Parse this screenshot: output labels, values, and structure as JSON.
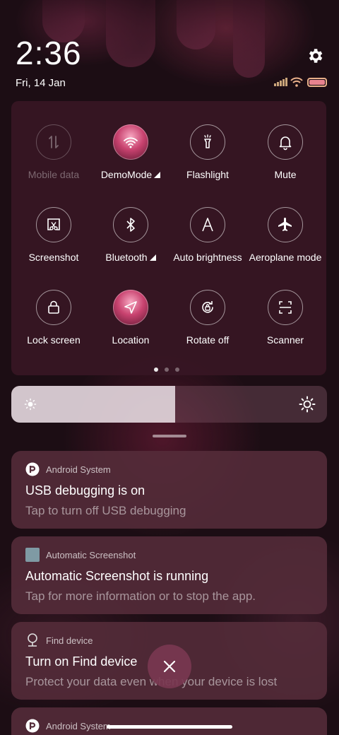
{
  "status_bar": {
    "time": "2:36",
    "date": "Fri, 14 Jan",
    "icons": [
      "signal-icon",
      "wifi-icon",
      "battery-icon"
    ]
  },
  "quick_settings": {
    "tiles": [
      {
        "label": "Mobile data",
        "icon": "mobile-data-icon",
        "state": "disabled"
      },
      {
        "label": "DemoMode",
        "icon": "wifi-icon",
        "state": "active",
        "expandable": true
      },
      {
        "label": "Flashlight",
        "icon": "flashlight-icon",
        "state": "off"
      },
      {
        "label": "Mute",
        "icon": "bell-icon",
        "state": "off"
      },
      {
        "label": "Screenshot",
        "icon": "screenshot-icon",
        "state": "off"
      },
      {
        "label": "Bluetooth",
        "icon": "bluetooth-icon",
        "state": "off",
        "expandable": true
      },
      {
        "label": "Auto brightness",
        "icon": "auto-brightness-icon",
        "state": "off"
      },
      {
        "label": "Aeroplane mode",
        "icon": "airplane-icon",
        "state": "off"
      },
      {
        "label": "Lock screen",
        "icon": "lock-icon",
        "state": "off"
      },
      {
        "label": "Location",
        "icon": "location-icon",
        "state": "active"
      },
      {
        "label": "Rotate off",
        "icon": "rotate-icon",
        "state": "off"
      },
      {
        "label": "Scanner",
        "icon": "scanner-icon",
        "state": "off"
      }
    ],
    "page_count": 3,
    "current_page": 1
  },
  "brightness": {
    "level": 0.52
  },
  "notifications": [
    {
      "app": "Android System",
      "title": "USB debugging is on",
      "body": "Tap to turn off USB debugging",
      "icon": "android-system-icon"
    },
    {
      "app": "Automatic Screenshot",
      "title": "Automatic Screenshot is running",
      "body": "Tap for more information or to stop the app.",
      "icon": "automatic-screenshot-icon"
    },
    {
      "app": "Find device",
      "title": "Turn on Find device",
      "body": "Protect your data even when your device is lost",
      "icon": "find-device-icon"
    },
    {
      "app": "Android System",
      "icon": "android-system-icon"
    }
  ],
  "colors": {
    "accent": "#c8426f",
    "panel": "#37162a",
    "notification_bg": "#552c3a"
  }
}
